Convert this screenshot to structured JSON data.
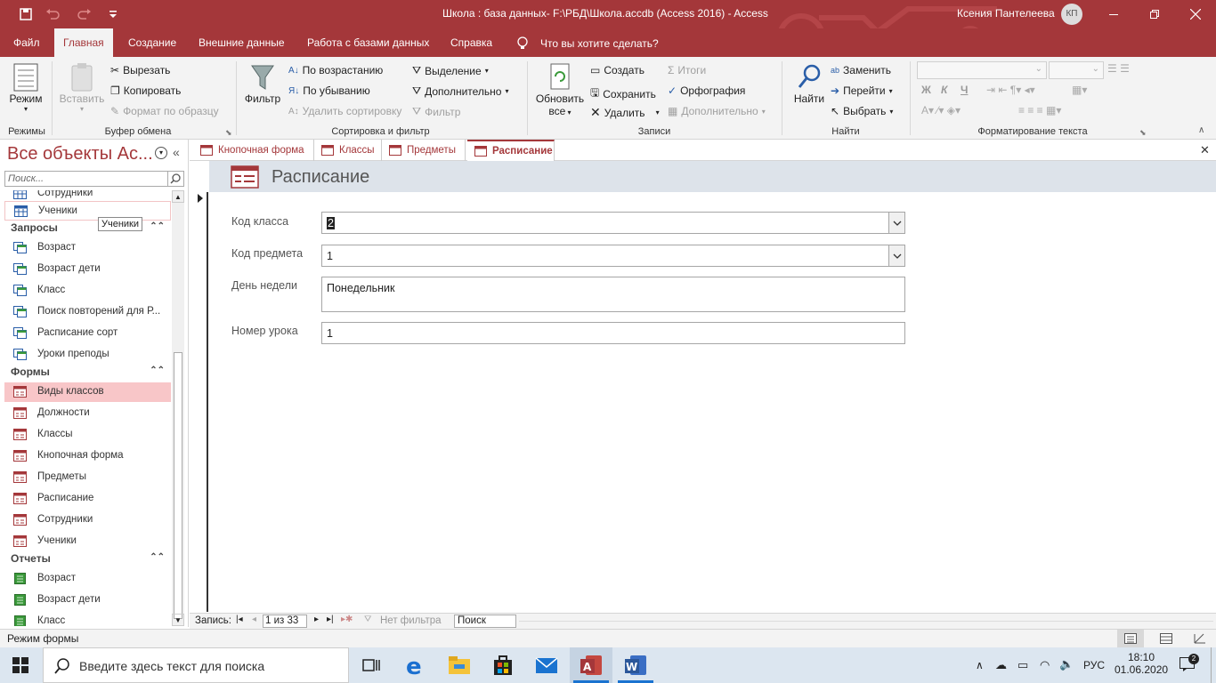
{
  "titlebar": {
    "title": "Школа : база данных- F:\\РБД\\Школа.accdb (Access 2016)  -  Access",
    "user": "Ксения Пантелеева",
    "avatar": "КП"
  },
  "menu": {
    "tabs": [
      "Файл",
      "Главная",
      "Создание",
      "Внешние данные",
      "Работа с базами данных",
      "Справка"
    ],
    "tell_me": "Что вы хотите сделать?"
  },
  "ribbon": {
    "views": {
      "mode": "Режим",
      "group": "Режимы"
    },
    "clipboard": {
      "paste": "Вставить",
      "cut": "Вырезать",
      "copy": "Копировать",
      "format_painter": "Формат по образцу",
      "group": "Буфер обмена"
    },
    "sort_filter": {
      "filter": "Фильтр",
      "asc": "По возрастанию",
      "desc": "По убыванию",
      "remove_sort": "Удалить сортировку",
      "selection": "Выделение",
      "advanced": "Дополнительно",
      "toggle_filter": "Фильтр",
      "group": "Сортировка и фильтр"
    },
    "records": {
      "refresh": "Обновить",
      "refresh2": "все",
      "new": "Создать",
      "save": "Сохранить",
      "delete": "Удалить",
      "totals": "Итоги",
      "spelling": "Орфография",
      "more": "Дополнительно",
      "group": "Записи"
    },
    "find": {
      "find": "Найти",
      "replace": "Заменить",
      "goto": "Перейти",
      "select": "Выбрать",
      "group": "Найти"
    },
    "text_format": {
      "bold": "Ж",
      "italic": "К",
      "underline": "Ч",
      "group": "Форматирование текста"
    }
  },
  "nav": {
    "header": "Все объекты Ac...",
    "search_placeholder": "Поиск...",
    "tooltip": "Ученики",
    "items_top": [
      "Сотрудники",
      "Ученики"
    ],
    "groups": [
      {
        "name": "Запросы",
        "items": [
          "Возраст",
          "Возраст дети",
          "Класс",
          "Поиск повторений для Р...",
          "Расписание сорт",
          "Уроки преподы"
        ]
      },
      {
        "name": "Формы",
        "items": [
          "Виды классов",
          "Должности",
          "Классы",
          "Кнопочная форма",
          "Предметы",
          "Расписание",
          "Сотрудники",
          "Ученики"
        ]
      },
      {
        "name": "Отчеты",
        "items": [
          "Возраст",
          "Возраст дети",
          "Класс"
        ]
      }
    ]
  },
  "doctabs": [
    "Кнопочная форма",
    "Классы",
    "Предметы",
    "Расписание"
  ],
  "form": {
    "title": "Расписание",
    "fields": [
      {
        "label": "Код класса",
        "value": "2"
      },
      {
        "label": "Код предмета",
        "value": "1"
      },
      {
        "label": "День недели",
        "value": "Понедельник"
      },
      {
        "label": "Номер урока",
        "value": "1"
      }
    ]
  },
  "recnav": {
    "label": "Запись:",
    "position": "1 из 33",
    "filter": "Нет фильтра",
    "search": "Поиск"
  },
  "status": {
    "mode": "Режим формы"
  },
  "taskbar": {
    "search": "Введите здесь текст для поиска",
    "lang": "РУС",
    "time": "18:10",
    "date": "01.06.2020",
    "notif": "2"
  }
}
